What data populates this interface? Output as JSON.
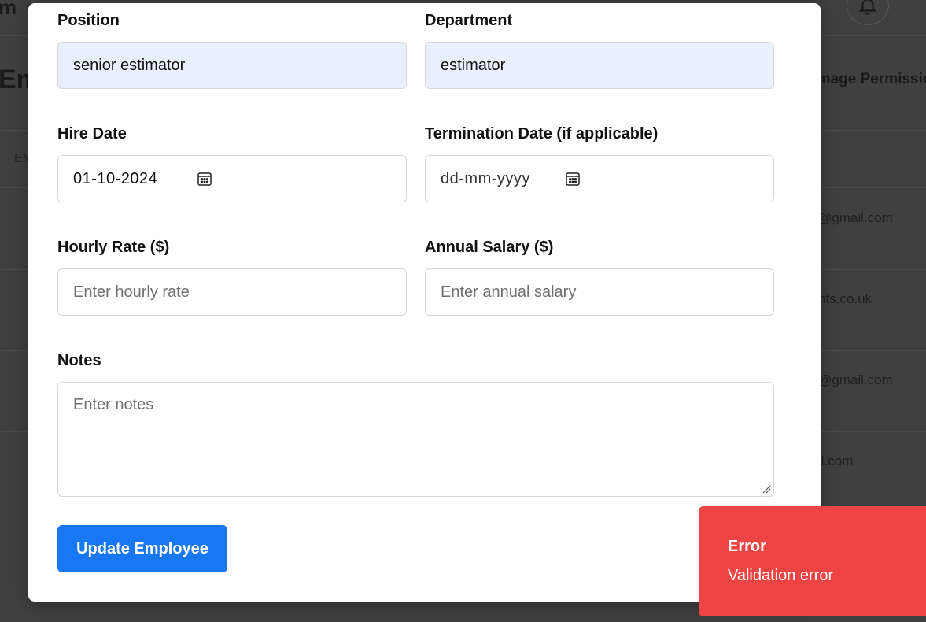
{
  "background": {
    "brand_fragment": "m",
    "title_fragment": "Em",
    "column_fragment": "EM",
    "permissions_fragment": "nage Permissio",
    "emails": [
      "@gmail.com",
      "nts.co.uk",
      "@gmail.com",
      "il.com"
    ]
  },
  "modal": {
    "position": {
      "label": "Position",
      "value": "senior estimator"
    },
    "department": {
      "label": "Department",
      "value": "estimator"
    },
    "hire_date": {
      "label": "Hire Date",
      "value": "01-10-2024"
    },
    "termination_date": {
      "label": "Termination Date (if applicable)",
      "placeholder": "dd-mm-yyyy"
    },
    "hourly_rate": {
      "label": "Hourly Rate ($)",
      "placeholder": "Enter hourly rate"
    },
    "annual_salary": {
      "label": "Annual Salary ($)",
      "placeholder": "Enter annual salary"
    },
    "notes": {
      "label": "Notes",
      "placeholder": "Enter notes"
    },
    "submit_label": "Update Employee"
  },
  "toast": {
    "title": "Error",
    "message": "Validation error",
    "color": "#ef4444"
  },
  "colors": {
    "accent": "#1877f2",
    "filled_input": "#e8f0fd"
  },
  "icons": [
    "calendar-icon",
    "bell-icon",
    "resize-grip-icon",
    "scroll-up-arrow-icon"
  ]
}
